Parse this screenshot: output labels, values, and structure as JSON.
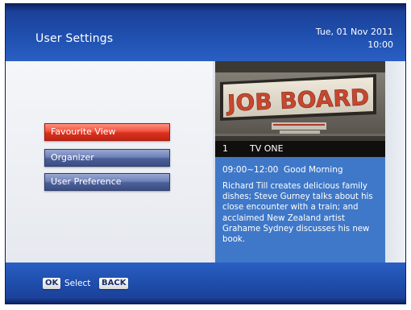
{
  "header": {
    "title": "User Settings",
    "date": "Tue, 01 Nov 2011",
    "time": "10:00"
  },
  "menu": {
    "items": [
      {
        "label": "Favourite View",
        "selected": true
      },
      {
        "label": "Organizer",
        "selected": false
      },
      {
        "label": "User Preference",
        "selected": false
      }
    ]
  },
  "preview": {
    "sign_text": "JOB BOARD",
    "channel_number": "1",
    "channel_name": "TV ONE"
  },
  "program": {
    "time_slot": "09:00~12:00",
    "title": "Good Morning",
    "description": "Richard Till creates delicious family dishes; Steve Gurney talks about his close encounter with a train; and acclaimed New Zealand artist Grahame Sydney discusses his new book."
  },
  "footer": {
    "ok_key": "OK",
    "ok_label": "Select",
    "back_key": "BACK"
  },
  "colors": {
    "header_blue": "#1f4fae",
    "selected_red": "#d8321f",
    "menu_blue": "#4c5f98",
    "info_blue": "#3f78c8"
  }
}
